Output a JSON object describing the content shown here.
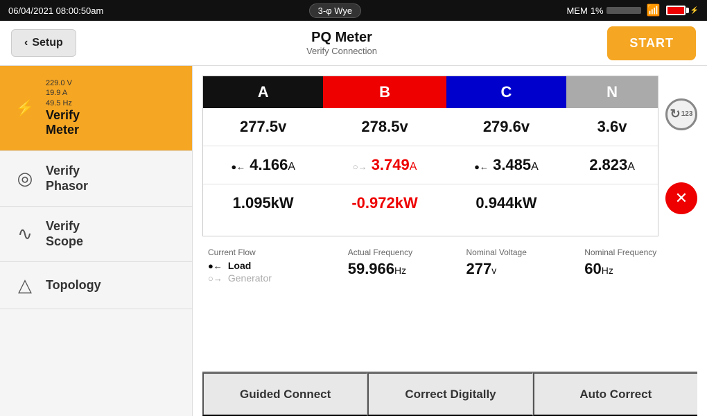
{
  "statusBar": {
    "datetime": "06/04/2021  08:00:50am",
    "connection": "3-φ Wye",
    "mem_label": "MEM",
    "mem_pct": "1%",
    "wifi_icon": "wifi",
    "battery_icon": "battery"
  },
  "header": {
    "back_label": "Setup",
    "title": "PQ Meter",
    "subtitle": "Verify Connection",
    "start_label": "START"
  },
  "sidebar": {
    "items": [
      {
        "id": "verify-meter",
        "label": "Verify\nMeter",
        "active": true,
        "values": [
          "229.0 V",
          "19.9 A",
          "49.5 Hz"
        ],
        "icon": "⚡"
      },
      {
        "id": "verify-phasor",
        "label": "Verify\nPhasor",
        "active": false,
        "icon": "◎"
      },
      {
        "id": "verify-scope",
        "label": "Verify\nScope",
        "active": false,
        "icon": "∿"
      },
      {
        "id": "topology",
        "label": "Topology",
        "active": false,
        "icon": "△"
      }
    ]
  },
  "table": {
    "headers": [
      "A",
      "B",
      "C",
      "N"
    ],
    "voltage_row": [
      "277.5v",
      "278.5v",
      "279.6v",
      "3.6v"
    ],
    "current_row": [
      "4.166A",
      "3.749A",
      "3.485A",
      "2.823A"
    ],
    "power_row": [
      "1.095kW",
      "-0.972kW",
      "0.944kW",
      ""
    ],
    "current_a_arrow": "solid",
    "current_b_arrow": "hollow",
    "current_b_color": "red",
    "current_c_arrow": "solid"
  },
  "info": {
    "current_flow_label": "Current Flow",
    "load_label": "Load",
    "generator_label": "Generator",
    "actual_freq_label": "Actual Frequency",
    "actual_freq_value": "59.966",
    "actual_freq_unit": "Hz",
    "nominal_volt_label": "Nominal Voltage",
    "nominal_volt_value": "277",
    "nominal_volt_unit": "v",
    "nominal_freq_label": "Nominal Frequency",
    "nominal_freq_value": "60",
    "nominal_freq_unit": "Hz"
  },
  "sideButtons": {
    "round_label": "123",
    "x_label": "✕"
  },
  "bottomBar": {
    "btn1": "Guided Connect",
    "btn2": "Correct Digitally",
    "btn3": "Auto Correct"
  }
}
